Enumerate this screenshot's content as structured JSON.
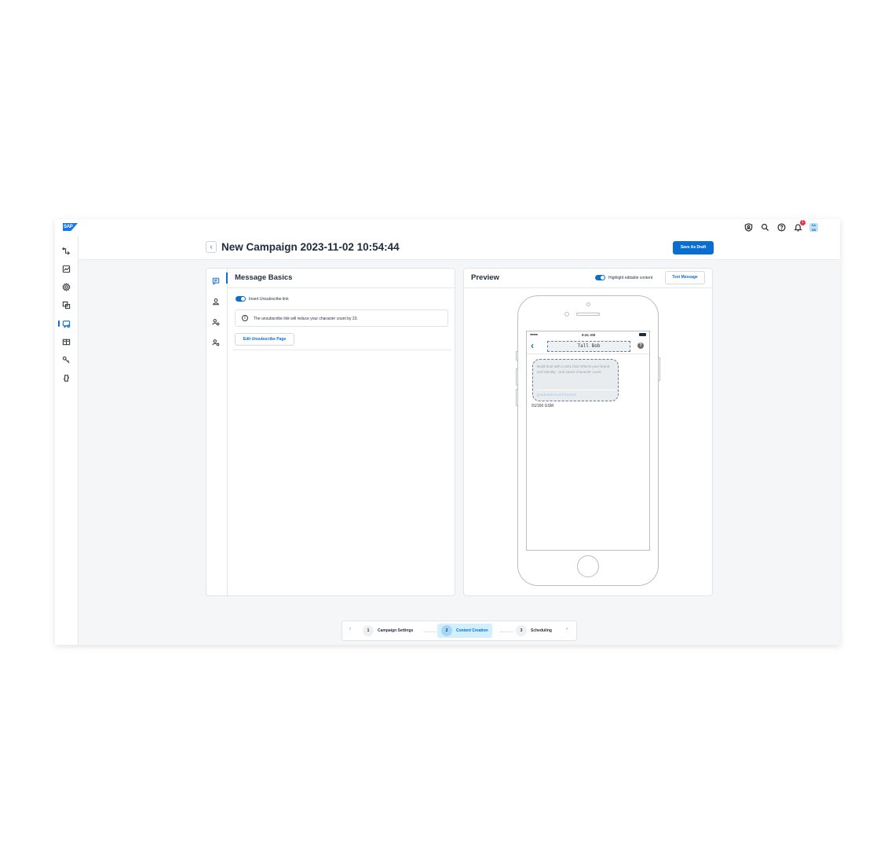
{
  "shellbar": {
    "logo": "SAP",
    "notification_count": "1",
    "avatar_initials": "SA SB"
  },
  "header": {
    "back_glyph": "‹",
    "title": "New Campaign 2023-11-02 10:54:44",
    "save_draft_label": "Save As Draft"
  },
  "message_basics": {
    "title": "Message Basics",
    "unsubscribe_toggle_label": "Insert Unsubscribe link",
    "unsubscribe_toggle_on": true,
    "info_text": "The unsubscribe link will reduce your character count by 23.",
    "edit_unsubscribe_label": "Edit Unsubscribe Page"
  },
  "preview": {
    "title": "Preview",
    "highlight_label": "Highlight editable content",
    "highlight_on": true,
    "test_message_label": "Test Message",
    "phone": {
      "signal": "●●●●●",
      "time": "9:41 AM",
      "sender": "Tall Bob",
      "back_glyph": "‹",
      "help_glyph": "?",
      "message_text": "Build trust with a URL that reflects your brand and identity - and saves character count.",
      "message_link": "yourbrand.sms/XXXXXX",
      "char_count": "91/160 GSM"
    }
  },
  "stepper": {
    "prev_glyph": "‹",
    "next_glyph": "›",
    "steps": [
      {
        "num": "1",
        "label": "Campaign Settings",
        "active": false
      },
      {
        "num": "2",
        "label": "Content Creation",
        "active": true
      },
      {
        "num": "3",
        "label": "Scheduling",
        "active": false
      }
    ]
  },
  "colors": {
    "accent": "#0a6ed1",
    "active_step_bg": "#d1effc",
    "background": "#f5f6f7"
  },
  "icons": {
    "sidenav": [
      "flow-icon",
      "analytics-icon",
      "settings-icon",
      "contacts-icon",
      "campaign-icon",
      "templates-icon",
      "keys-icon",
      "integrations-icon"
    ],
    "card_nav": [
      "message-icon",
      "person-icon",
      "users-settings-icon",
      "users-settings-icon"
    ],
    "shellbar": [
      "shield-user-icon",
      "search-icon",
      "help-icon",
      "bell-icon"
    ]
  }
}
